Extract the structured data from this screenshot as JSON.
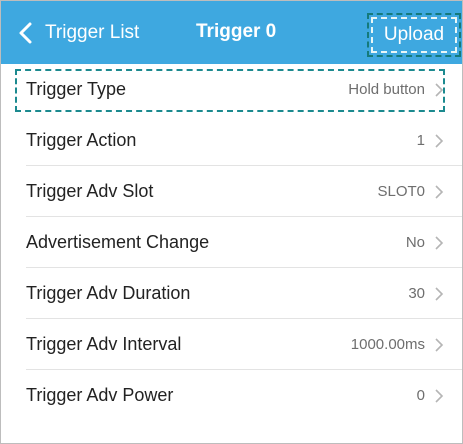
{
  "navbar": {
    "back_label": "Trigger List",
    "title": "Trigger 0",
    "upload_label": "Upload",
    "background_color": "#3ea8e0"
  },
  "rows": [
    {
      "label": "Trigger Type",
      "value": "Hold button",
      "highlighted": true
    },
    {
      "label": "Trigger Action",
      "value": "1"
    },
    {
      "label": "Trigger Adv Slot",
      "value": "SLOT0"
    },
    {
      "label": "Advertisement Change",
      "value": "No"
    },
    {
      "label": "Trigger Adv Duration",
      "value": "30"
    },
    {
      "label": "Trigger Adv Interval",
      "value": "1000.00ms"
    },
    {
      "label": "Trigger Adv Power",
      "value": "0"
    }
  ],
  "icons": {
    "back": "chevron-left-icon",
    "row_disclosure": "chevron-right-icon"
  },
  "colors": {
    "highlight_dash": "#1c8a8f",
    "text": "#222222",
    "value_text": "#6e6e6e"
  }
}
